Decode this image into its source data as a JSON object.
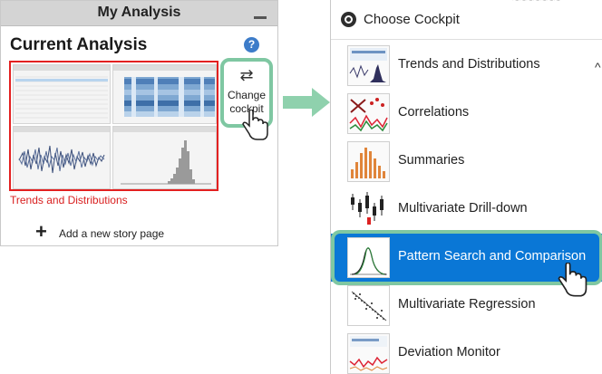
{
  "left_panel": {
    "title": "My Analysis",
    "current_title": "Current Analysis",
    "help_glyph": "?",
    "thumbnail_caption": "Trends and Distributions",
    "change_glyph": "⇄",
    "change_label_line1": "Change",
    "change_label_line2": "cockpit",
    "add_glyph": "+",
    "add_label": "Add a new story page"
  },
  "menu": {
    "title": "Choose Cockpit",
    "caret": "^",
    "items": [
      {
        "label": "Trends and Distributions",
        "selected": false
      },
      {
        "label": "Correlations",
        "selected": false
      },
      {
        "label": "Summaries",
        "selected": false
      },
      {
        "label": "Multivariate Drill-down",
        "selected": false
      },
      {
        "label": "Pattern Search and Comparison",
        "selected": true
      },
      {
        "label": "Multivariate Regression",
        "selected": false
      },
      {
        "label": "Deviation Monitor",
        "selected": false
      }
    ]
  },
  "colors": {
    "selection": "#0a77d6",
    "highlight_outline": "#7fc7a2",
    "thumbnail_border": "#e32020",
    "caption": "#d92020"
  },
  "icons": [
    "minimize-icon",
    "help-icon",
    "swap-icon",
    "pointer-hand-icon",
    "plus-icon",
    "arrow-right-icon",
    "cockpit-icon"
  ]
}
